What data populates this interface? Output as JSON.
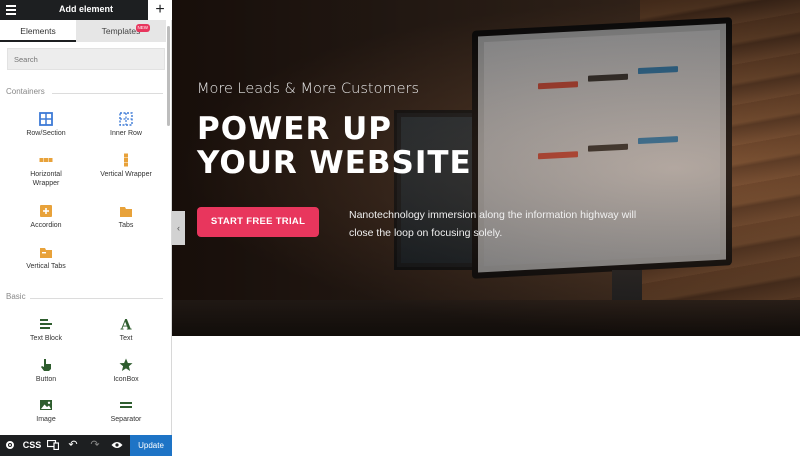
{
  "header": {
    "title": "Add element"
  },
  "tabs": [
    {
      "label": "Elements"
    },
    {
      "label": "Templates",
      "badge": "NEW"
    }
  ],
  "search": {
    "placeholder": "Search"
  },
  "sections": {
    "containers": {
      "title": "Containers",
      "items": [
        {
          "label": "Row/Section",
          "icon": "row-section-icon"
        },
        {
          "label": "Inner Row",
          "icon": "inner-row-icon"
        },
        {
          "label": "Horizontal\nWrapper",
          "icon": "horizontal-wrapper-icon"
        },
        {
          "label": "Vertical Wrapper",
          "icon": "vertical-wrapper-icon"
        },
        {
          "label": "Accordion",
          "icon": "accordion-icon"
        },
        {
          "label": "Tabs",
          "icon": "tabs-icon"
        },
        {
          "label": "Vertical Tabs",
          "icon": "vertical-tabs-icon"
        }
      ]
    },
    "basic": {
      "title": "Basic",
      "items": [
        {
          "label": "Text Block",
          "icon": "text-block-icon"
        },
        {
          "label": "Text",
          "icon": "text-icon"
        },
        {
          "label": "Button",
          "icon": "button-icon"
        },
        {
          "label": "IconBox",
          "icon": "iconbox-icon"
        },
        {
          "label": "Image",
          "icon": "image-icon"
        },
        {
          "label": "Separator",
          "icon": "separator-icon"
        }
      ]
    }
  },
  "footer": {
    "css_label": "CSS",
    "update_label": "Update"
  },
  "hero": {
    "subtitle": "More Leads & More Customers",
    "title_line1": "POWER UP",
    "title_line2": "YOUR WEBSITE",
    "cta_label": "START FREE TRIAL",
    "description": "Nanotechnology immersion along the information highway will close the loop on focusing solely."
  },
  "colors": {
    "accent": "#e8365d",
    "update_button": "#1e74c6",
    "topbar": "#1d1f21",
    "icon_blue": "#3d7ad6",
    "icon_orange": "#e8a23a",
    "icon_green": "#2e5d2e"
  }
}
